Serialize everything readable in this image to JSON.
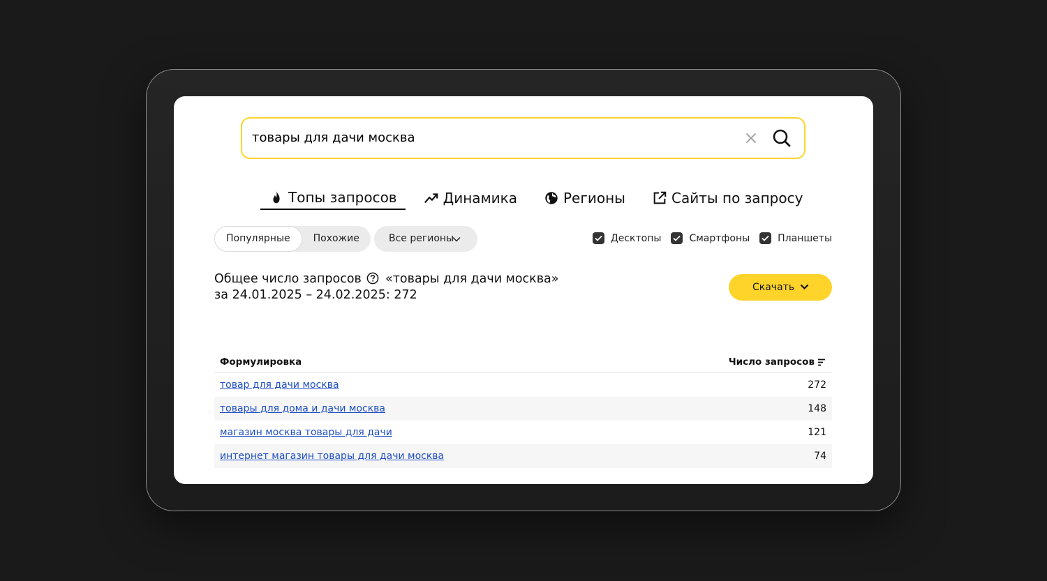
{
  "search": {
    "value": "товары для дачи москва"
  },
  "tabs": [
    {
      "label": "Топы запросов",
      "icon": "fire-icon",
      "active": true
    },
    {
      "label": "Динамика",
      "icon": "trend-up-icon",
      "active": false
    },
    {
      "label": "Регионы",
      "icon": "globe-icon",
      "active": false
    },
    {
      "label": "Сайты по запросу",
      "icon": "external-link-icon",
      "active": false
    }
  ],
  "filters": {
    "segments": [
      "Популярные",
      "Похожие"
    ],
    "active_segment": "Популярные",
    "region_label": "Все регионы",
    "devices": [
      {
        "label": "Десктопы",
        "checked": true
      },
      {
        "label": "Смартфоны",
        "checked": true
      },
      {
        "label": "Планшеты",
        "checked": true
      }
    ]
  },
  "summary": {
    "line1_prefix": "Общее число запросов",
    "line1_query": "«товары для дачи москва»",
    "line2": "за 24.01.2025 – 24.02.2025: 272",
    "download_label": "Скачать"
  },
  "table": {
    "col_phrase": "Формулировка",
    "col_count": "Число запросов",
    "rows": [
      {
        "phrase": "товар для дачи москва",
        "count": "272"
      },
      {
        "phrase": "товары для дома и дачи москва",
        "count": "148"
      },
      {
        "phrase": "магазин москва товары для дачи",
        "count": "121"
      },
      {
        "phrase": "интернет магазин товары для дачи москва",
        "count": "74"
      }
    ]
  },
  "colors": {
    "accent": "#fed42b",
    "link": "#1e4ec4",
    "background": "#1a1a1a"
  }
}
